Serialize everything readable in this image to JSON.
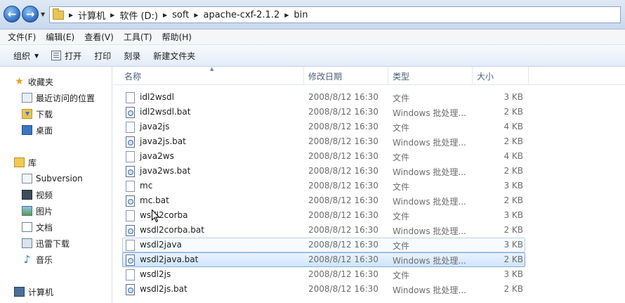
{
  "address": {
    "crumbs": [
      "计算机",
      "软件 (D:)",
      "soft",
      "apache-cxf-2.1.2",
      "bin"
    ]
  },
  "menu": [
    "文件(F)",
    "编辑(E)",
    "查看(V)",
    "工具(T)",
    "帮助(H)"
  ],
  "toolbar": {
    "organize": "组织",
    "open": "打开",
    "print": "打印",
    "burn": "刻录",
    "new_folder": "新建文件夹"
  },
  "nav": {
    "favorites": "收藏夹",
    "recent": "最近访问的位置",
    "downloads": "下载",
    "desktop": "桌面",
    "libraries": "库",
    "subversion": "Subversion",
    "videos": "视频",
    "pictures": "图片",
    "documents": "文档",
    "thunder": "迅雷下载",
    "music": "音乐",
    "computer": "计算机"
  },
  "columns": {
    "name": "名称",
    "date": "修改日期",
    "type": "类型",
    "size": "大小"
  },
  "files": [
    {
      "name": "idl2wsdl",
      "date": "2008/8/12 16:30",
      "type": "文件",
      "size": "3 KB"
    },
    {
      "name": "idl2wsdl.bat",
      "date": "2008/8/12 16:30",
      "type": "Windows 批处理...",
      "size": "2 KB"
    },
    {
      "name": "java2js",
      "date": "2008/8/12 16:30",
      "type": "文件",
      "size": "4 KB"
    },
    {
      "name": "java2js.bat",
      "date": "2008/8/12 16:30",
      "type": "Windows 批处理...",
      "size": "2 KB"
    },
    {
      "name": "java2ws",
      "date": "2008/8/12 16:30",
      "type": "文件",
      "size": "4 KB"
    },
    {
      "name": "java2ws.bat",
      "date": "2008/8/12 16:30",
      "type": "Windows 批处理...",
      "size": "2 KB"
    },
    {
      "name": "mc",
      "date": "2008/8/12 16:30",
      "type": "文件",
      "size": "3 KB"
    },
    {
      "name": "mc.bat",
      "date": "2008/8/12 16:30",
      "type": "Windows 批处理...",
      "size": "2 KB"
    },
    {
      "name": "wsdl2corba",
      "date": "2008/8/12 16:30",
      "type": "文件",
      "size": "3 KB"
    },
    {
      "name": "wsdl2corba.bat",
      "date": "2008/8/12 16:30",
      "type": "Windows 批处理...",
      "size": "2 KB"
    },
    {
      "name": "wsdl2java",
      "date": "2008/8/12 16:30",
      "type": "文件",
      "size": "3 KB"
    },
    {
      "name": "wsdl2java.bat",
      "date": "2008/8/12 16:30",
      "type": "Windows 批处理...",
      "size": "2 KB"
    },
    {
      "name": "wsdl2js",
      "date": "2008/8/12 16:30",
      "type": "文件",
      "size": "3 KB"
    },
    {
      "name": "wsdl2js.bat",
      "date": "2008/8/12 16:30",
      "type": "Windows 批处理...",
      "size": "2 KB"
    }
  ]
}
